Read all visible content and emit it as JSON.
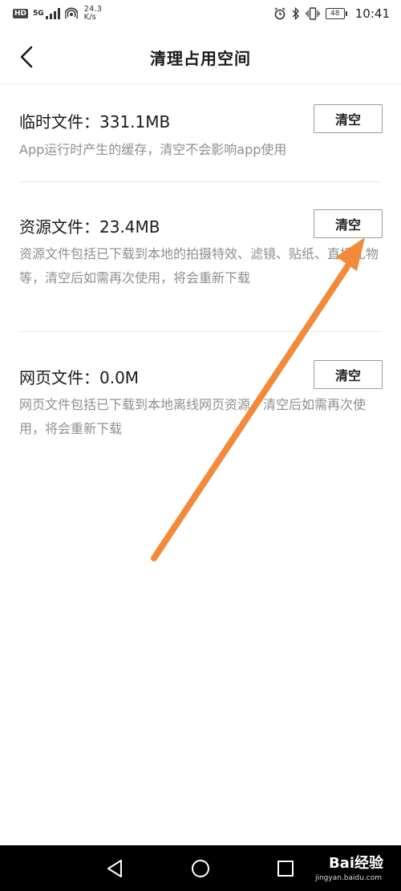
{
  "status_bar": {
    "hd": "HD",
    "net_5g": "5G",
    "speed_value": "24.3",
    "speed_unit": "K/s",
    "battery": "48",
    "time": "10:41"
  },
  "header": {
    "title": "清理占用空间"
  },
  "sections": [
    {
      "title": "临时文件：331.1MB",
      "button": "清空",
      "description": "App运行时产生的缓存，清空不会影响app使用"
    },
    {
      "title": "资源文件：23.4MB",
      "button": "清空",
      "description": "资源文件包括已下载到本地的拍摄特效、滤镜、贴纸、直播礼物等，清空后如需再次使用，将会重新下载"
    },
    {
      "title": "网页文件：0.0M",
      "button": "清空",
      "description": "网页文件包括已下载到本地离线网页资源，清空后如需再次使用，将会重新下载"
    }
  ],
  "watermark": {
    "brand": "Bai经验",
    "url": "jingyan.baidu.com"
  },
  "colors": {
    "annotation_arrow": "#f28a3a",
    "description_text": "#8f8f8f",
    "nav_bar": "#000000"
  }
}
